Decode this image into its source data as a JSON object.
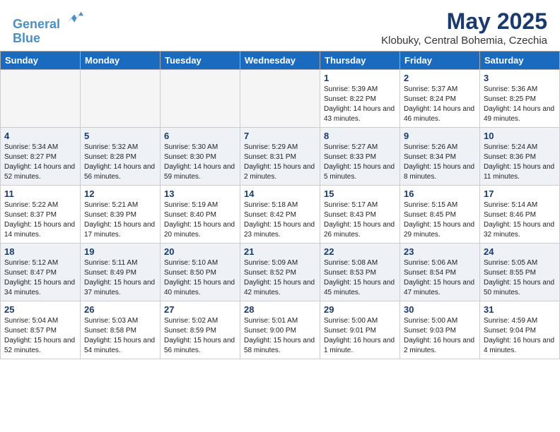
{
  "header": {
    "logo_line1": "General",
    "logo_line2": "Blue",
    "month": "May 2025",
    "location": "Klobuky, Central Bohemia, Czechia"
  },
  "weekdays": [
    "Sunday",
    "Monday",
    "Tuesday",
    "Wednesday",
    "Thursday",
    "Friday",
    "Saturday"
  ],
  "weeks": [
    [
      {
        "day": "",
        "info": ""
      },
      {
        "day": "",
        "info": ""
      },
      {
        "day": "",
        "info": ""
      },
      {
        "day": "",
        "info": ""
      },
      {
        "day": "1",
        "info": "Sunrise: 5:39 AM\nSunset: 8:22 PM\nDaylight: 14 hours\nand 43 minutes."
      },
      {
        "day": "2",
        "info": "Sunrise: 5:37 AM\nSunset: 8:24 PM\nDaylight: 14 hours\nand 46 minutes."
      },
      {
        "day": "3",
        "info": "Sunrise: 5:36 AM\nSunset: 8:25 PM\nDaylight: 14 hours\nand 49 minutes."
      }
    ],
    [
      {
        "day": "4",
        "info": "Sunrise: 5:34 AM\nSunset: 8:27 PM\nDaylight: 14 hours\nand 52 minutes."
      },
      {
        "day": "5",
        "info": "Sunrise: 5:32 AM\nSunset: 8:28 PM\nDaylight: 14 hours\nand 56 minutes."
      },
      {
        "day": "6",
        "info": "Sunrise: 5:30 AM\nSunset: 8:30 PM\nDaylight: 14 hours\nand 59 minutes."
      },
      {
        "day": "7",
        "info": "Sunrise: 5:29 AM\nSunset: 8:31 PM\nDaylight: 15 hours\nand 2 minutes."
      },
      {
        "day": "8",
        "info": "Sunrise: 5:27 AM\nSunset: 8:33 PM\nDaylight: 15 hours\nand 5 minutes."
      },
      {
        "day": "9",
        "info": "Sunrise: 5:26 AM\nSunset: 8:34 PM\nDaylight: 15 hours\nand 8 minutes."
      },
      {
        "day": "10",
        "info": "Sunrise: 5:24 AM\nSunset: 8:36 PM\nDaylight: 15 hours\nand 11 minutes."
      }
    ],
    [
      {
        "day": "11",
        "info": "Sunrise: 5:22 AM\nSunset: 8:37 PM\nDaylight: 15 hours\nand 14 minutes."
      },
      {
        "day": "12",
        "info": "Sunrise: 5:21 AM\nSunset: 8:39 PM\nDaylight: 15 hours\nand 17 minutes."
      },
      {
        "day": "13",
        "info": "Sunrise: 5:19 AM\nSunset: 8:40 PM\nDaylight: 15 hours\nand 20 minutes."
      },
      {
        "day": "14",
        "info": "Sunrise: 5:18 AM\nSunset: 8:42 PM\nDaylight: 15 hours\nand 23 minutes."
      },
      {
        "day": "15",
        "info": "Sunrise: 5:17 AM\nSunset: 8:43 PM\nDaylight: 15 hours\nand 26 minutes."
      },
      {
        "day": "16",
        "info": "Sunrise: 5:15 AM\nSunset: 8:45 PM\nDaylight: 15 hours\nand 29 minutes."
      },
      {
        "day": "17",
        "info": "Sunrise: 5:14 AM\nSunset: 8:46 PM\nDaylight: 15 hours\nand 32 minutes."
      }
    ],
    [
      {
        "day": "18",
        "info": "Sunrise: 5:12 AM\nSunset: 8:47 PM\nDaylight: 15 hours\nand 34 minutes."
      },
      {
        "day": "19",
        "info": "Sunrise: 5:11 AM\nSunset: 8:49 PM\nDaylight: 15 hours\nand 37 minutes."
      },
      {
        "day": "20",
        "info": "Sunrise: 5:10 AM\nSunset: 8:50 PM\nDaylight: 15 hours\nand 40 minutes."
      },
      {
        "day": "21",
        "info": "Sunrise: 5:09 AM\nSunset: 8:52 PM\nDaylight: 15 hours\nand 42 minutes."
      },
      {
        "day": "22",
        "info": "Sunrise: 5:08 AM\nSunset: 8:53 PM\nDaylight: 15 hours\nand 45 minutes."
      },
      {
        "day": "23",
        "info": "Sunrise: 5:06 AM\nSunset: 8:54 PM\nDaylight: 15 hours\nand 47 minutes."
      },
      {
        "day": "24",
        "info": "Sunrise: 5:05 AM\nSunset: 8:55 PM\nDaylight: 15 hours\nand 50 minutes."
      }
    ],
    [
      {
        "day": "25",
        "info": "Sunrise: 5:04 AM\nSunset: 8:57 PM\nDaylight: 15 hours\nand 52 minutes."
      },
      {
        "day": "26",
        "info": "Sunrise: 5:03 AM\nSunset: 8:58 PM\nDaylight: 15 hours\nand 54 minutes."
      },
      {
        "day": "27",
        "info": "Sunrise: 5:02 AM\nSunset: 8:59 PM\nDaylight: 15 hours\nand 56 minutes."
      },
      {
        "day": "28",
        "info": "Sunrise: 5:01 AM\nSunset: 9:00 PM\nDaylight: 15 hours\nand 58 minutes."
      },
      {
        "day": "29",
        "info": "Sunrise: 5:00 AM\nSunset: 9:01 PM\nDaylight: 16 hours\nand 1 minute."
      },
      {
        "day": "30",
        "info": "Sunrise: 5:00 AM\nSunset: 9:03 PM\nDaylight: 16 hours\nand 2 minutes."
      },
      {
        "day": "31",
        "info": "Sunrise: 4:59 AM\nSunset: 9:04 PM\nDaylight: 16 hours\nand 4 minutes."
      }
    ]
  ]
}
